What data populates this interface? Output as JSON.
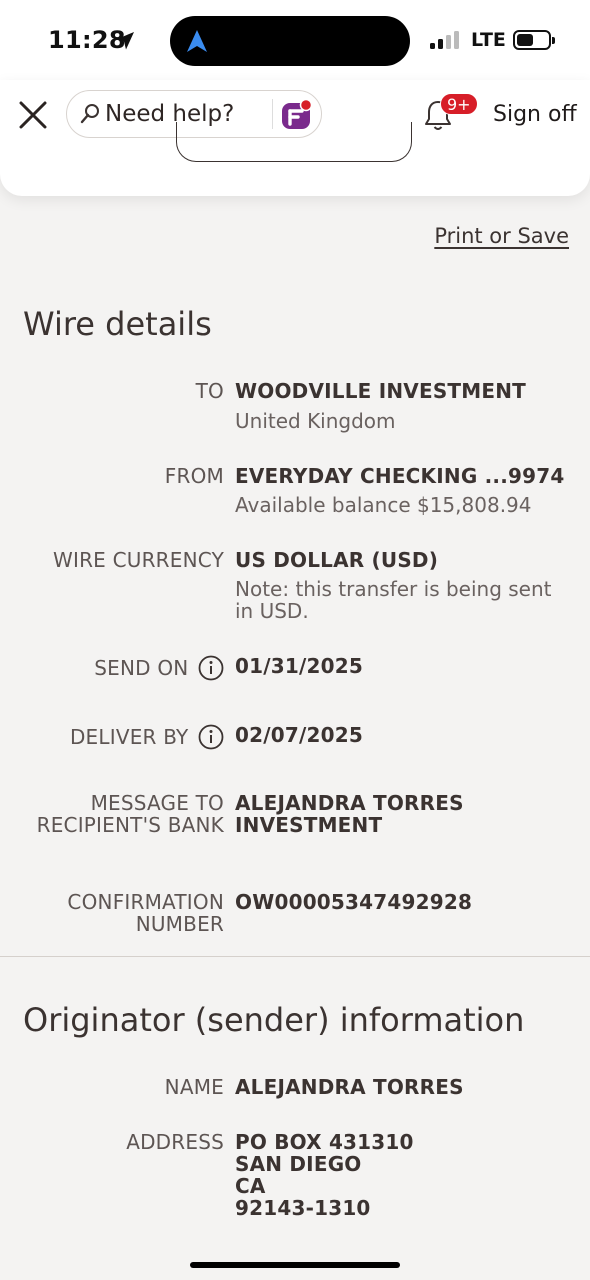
{
  "status_bar": {
    "time": "11:28",
    "network": "LTE"
  },
  "header": {
    "help_placeholder": "Need help?",
    "notification_badge": "9+",
    "sign_off_label": "Sign off"
  },
  "print_link": "Print or Save",
  "wire_details": {
    "title": "Wire details",
    "to_label": "TO",
    "to_value": "WOODVILLE INVESTMENT",
    "to_sub": "United Kingdom",
    "from_label": "FROM",
    "from_value": "EVERYDAY CHECKING ...9974",
    "from_sub": "Available balance $15,808.94",
    "currency_label": "WIRE CURRENCY",
    "currency_value": "US DOLLAR (USD)",
    "currency_note": "Note: this transfer is being sent in USD.",
    "send_on_label": "SEND ON",
    "send_on_value": "01/31/2025",
    "deliver_by_label": "DELIVER BY",
    "deliver_by_value": "02/07/2025",
    "message_label": "MESSAGE TO RECIPIENT'S BANK",
    "message_value": "ALEJANDRA TORRES INVESTMENT",
    "confirmation_label": "CONFIRMATION NUMBER",
    "confirmation_value": "OW00005347492928"
  },
  "originator": {
    "title": "Originator (sender) information",
    "name_label": "NAME",
    "name_value": "ALEJANDRA TORRES",
    "address_label": "ADDRESS",
    "address_lines": [
      "PO BOX 431310",
      "SAN DIEGO",
      "CA",
      "92143-1310"
    ]
  },
  "colors": {
    "brand_red": "#d71e28",
    "brand_purple": "#7a2a8c",
    "text": "#3b3331"
  },
  "icons": [
    "location-arrow-icon",
    "close-icon",
    "search-icon",
    "fargo-assistant-icon",
    "bell-icon",
    "info-icon"
  ]
}
